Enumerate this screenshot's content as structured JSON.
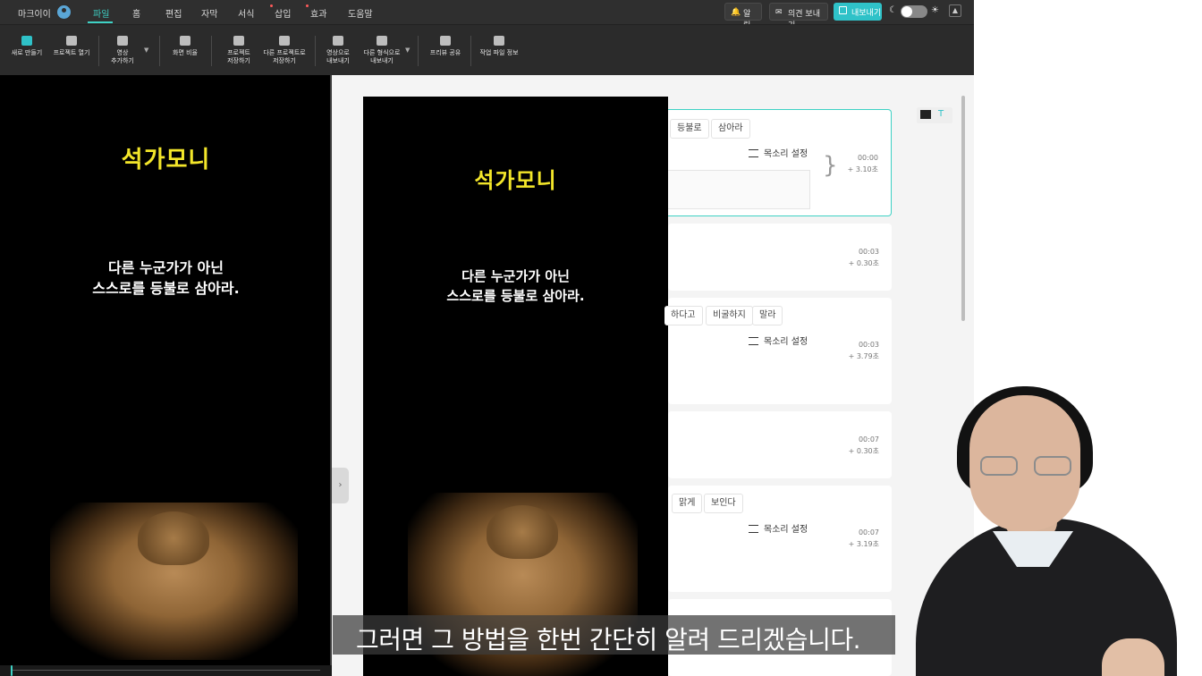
{
  "topbar": {
    "user_name": "마크이이",
    "menu": [
      "파일",
      "홈",
      "편집",
      "자막",
      "서식",
      "삽입",
      "효과",
      "도움말"
    ],
    "active_menu": "파일",
    "notify_label": "알림",
    "feedback_label": "의견 보내기",
    "export_label": "내보내기"
  },
  "toolbar": {
    "new": "새로 만들기",
    "open_project": "프로젝트 열기",
    "add_video_l1": "영상",
    "add_video_l2": "추가하기",
    "screen_ratio": "화면 비율",
    "save_l1": "프로젝트",
    "save_l2": "저장하기",
    "save_as_l1": "다른 프로젝트로",
    "save_as_l2": "저장하기",
    "export_video_l1": "영상으로",
    "export_video_l2": "내보내기",
    "export_other_l1": "다른 형식으로",
    "export_other_l2": "내보내기",
    "share_review": "프리뷰 공유",
    "file_info": "작업 파일 정보"
  },
  "preview": {
    "title": "석가모니",
    "quote_line1": "다른 누군가가 아닌",
    "quote_line2": "스스로를 등불로 삼아라."
  },
  "cards": [
    {
      "chips": [
        "등불로",
        "삼아라"
      ],
      "voice": "목소리 설정",
      "time_start": "00:00",
      "duration": "+ 3.10초"
    },
    {
      "time_start": "00:03",
      "duration": "+ 0.30초"
    },
    {
      "chips": [
        "하다고",
        "비굴하지",
        "말라"
      ],
      "voice": "목소리 설정",
      "time_start": "00:03",
      "duration": "+ 3.79초"
    },
    {
      "time_start": "00:07",
      "duration": "+ 0.30초"
    },
    {
      "chips": [
        "맑게",
        "보인다"
      ],
      "voice": "목소리 설정",
      "time_start": "00:07",
      "duration": "+ 3.19초"
    }
  ],
  "subtitle": "그러면 그 방법을 한번 간단히 알려 드리겠습니다.",
  "colors": {
    "accent": "#3ed1c4",
    "title_yellow": "#f3e62a",
    "export_btn": "#2fc2c8"
  }
}
